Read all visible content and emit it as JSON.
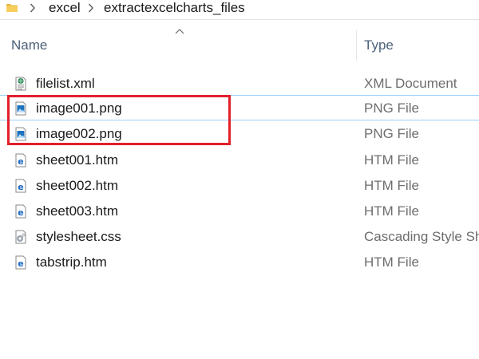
{
  "breadcrumb": {
    "items": [
      "excel",
      "extractexcelcharts_files"
    ]
  },
  "columns": {
    "name": "Name",
    "type": "Type"
  },
  "colors": {
    "highlight": "#e2202a",
    "header_text": "#4c607a",
    "type_text": "#6d6d6d",
    "selection_line": "#99d1ff"
  },
  "files": [
    {
      "name": "filelist.xml",
      "type": "XML Document",
      "icon": "xml-file-icon"
    },
    {
      "name": "image001.png",
      "type": "PNG File",
      "icon": "image-file-icon"
    },
    {
      "name": "image002.png",
      "type": "PNG File",
      "icon": "image-file-icon"
    },
    {
      "name": "sheet001.htm",
      "type": "HTM File",
      "icon": "edge-htm-icon"
    },
    {
      "name": "sheet002.htm",
      "type": "HTM File",
      "icon": "edge-htm-icon"
    },
    {
      "name": "sheet003.htm",
      "type": "HTM File",
      "icon": "edge-htm-icon"
    },
    {
      "name": "stylesheet.css",
      "type": "Cascading Style Sh",
      "icon": "css-file-icon"
    },
    {
      "name": "tabstrip.htm",
      "type": "HTM File",
      "icon": "edge-htm-icon"
    }
  ]
}
